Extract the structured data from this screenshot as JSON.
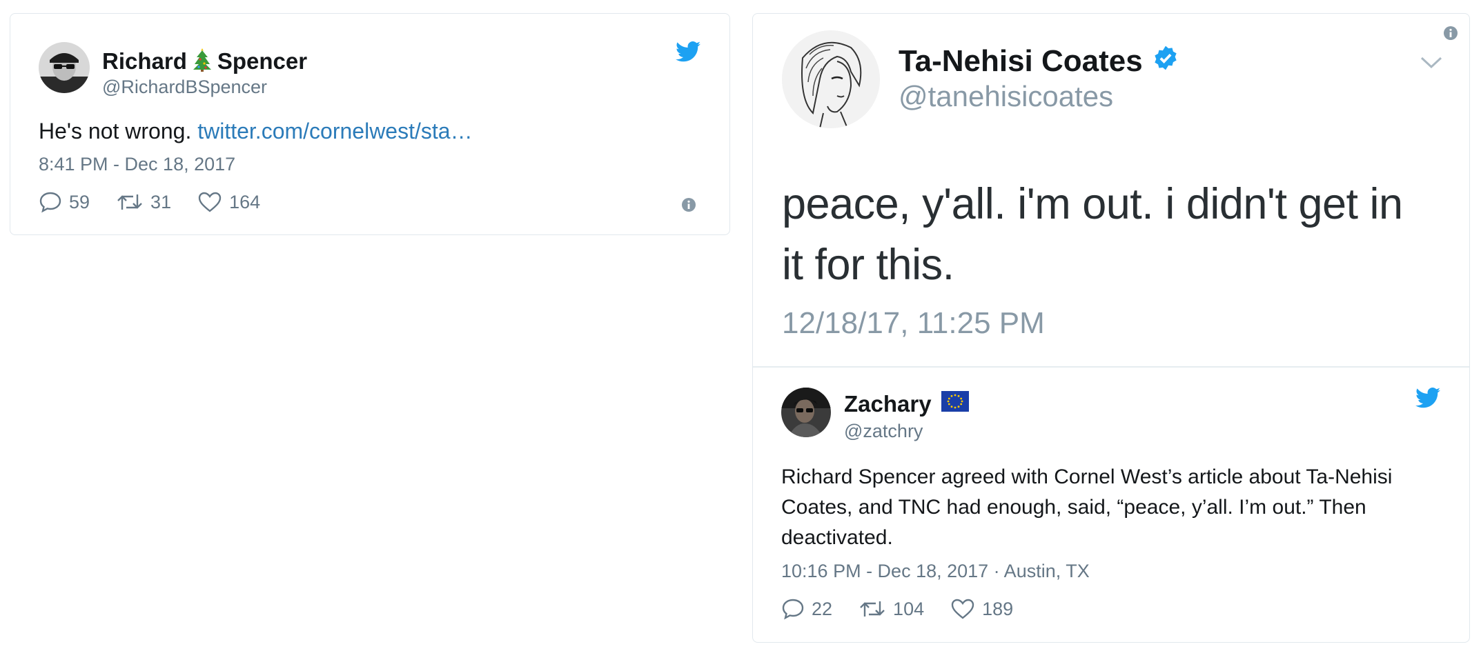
{
  "tweet1": {
    "name_first": "Richard",
    "name_last": "Spencer",
    "emoji_icon": "christmas-tree-icon",
    "handle": "@RichardBSpencer",
    "text": "He's not wrong. ",
    "link": "twitter.com/cornelwest/sta…",
    "timestamp": "8:41 PM - Dec 18, 2017",
    "replies": "59",
    "retweets": "31",
    "likes": "164"
  },
  "tweet2": {
    "name": "Ta-Nehisi Coates",
    "handle": "@tanehisicoates",
    "text": "peace, y'all. i'm out. i didn't get in it for this.",
    "timestamp": "12/18/17, 11:25 PM"
  },
  "tweet3": {
    "name": "Zachary",
    "flag_icon": "eu-flag-icon",
    "handle": "@zatchry",
    "text": "Richard Spencer agreed with Cornel West’s article about Ta-Nehisi Coates, and TNC had enough, said, “peace, y’all. I’m out.” Then deactivated.",
    "timestamp": "10:16 PM - Dec 18, 2017 · Austin, TX",
    "replies": "22",
    "retweets": "104",
    "likes": "189"
  },
  "colors": {
    "twitter_blue": "#1da1f2",
    "link": "#2b7bb9",
    "meta_gray": "#657786"
  }
}
